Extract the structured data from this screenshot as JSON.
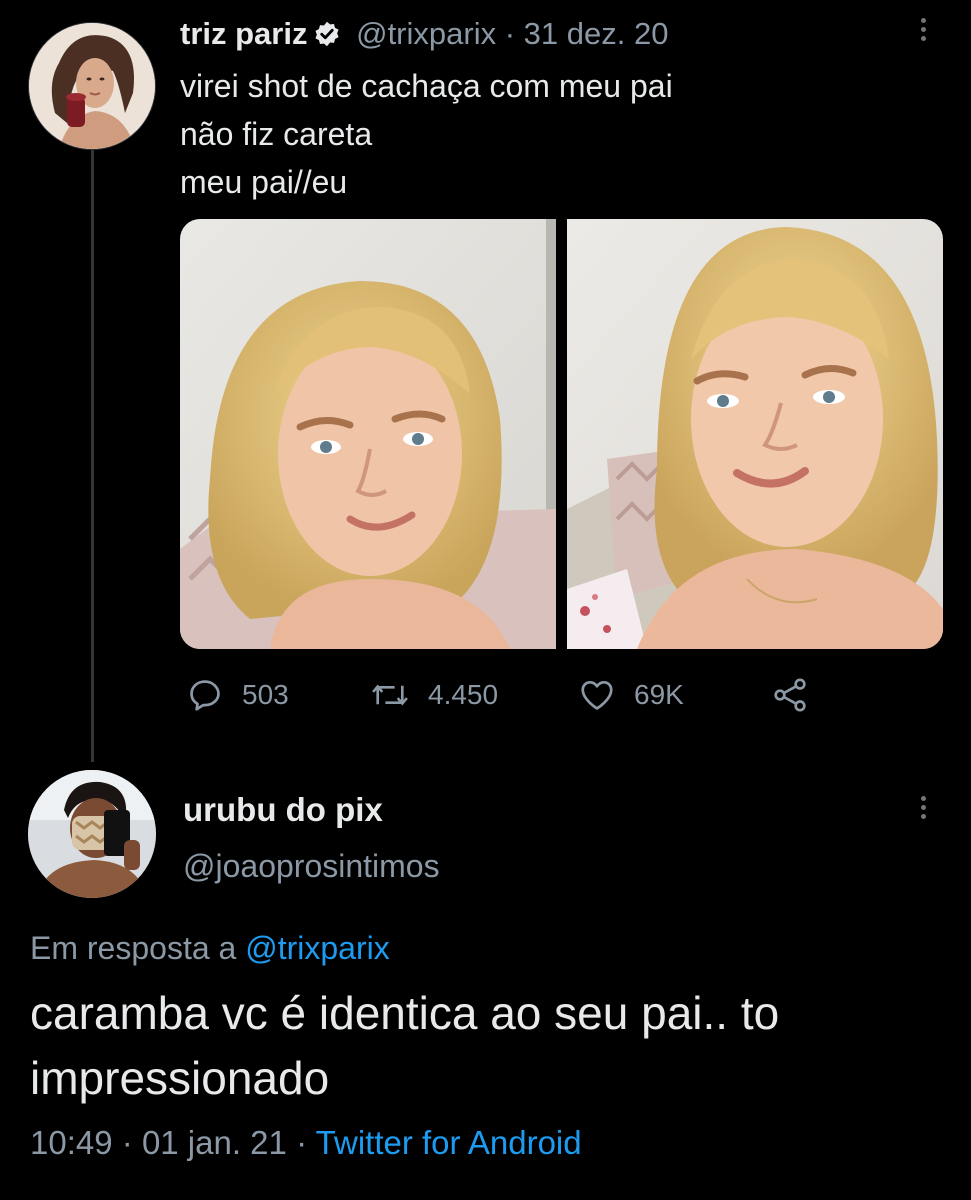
{
  "tweet": {
    "author_name": "triz pariz",
    "handle": "@trixparix",
    "date": "31 dez. 20",
    "separator": "·",
    "body_lines": [
      "virei shot de cachaça com meu pai",
      "não fiz careta",
      "meu pai//eu"
    ],
    "actions": {
      "replies": "503",
      "retweets": "4.450",
      "likes": "69K"
    },
    "icons": {
      "verified": "verified-badge-icon",
      "more": "more-options-icon",
      "reply": "reply-icon",
      "retweet": "retweet-icon",
      "like": "heart-icon",
      "share": "share-icon"
    }
  },
  "reply": {
    "author_name": "urubu do pix",
    "handle": "@joaoprosintimos",
    "replying_prefix": "Em resposta a",
    "replying_to": "@trixparix",
    "text": "caramba vc é identica ao seu pai.. to impressionado",
    "time": "10:49",
    "date": "01 jan. 21",
    "separator": "·",
    "source": "Twitter for Android"
  },
  "colors": {
    "background": "#000000",
    "text": "#e7e9ea",
    "muted": "#8b98a5",
    "link": "#1d9bf0",
    "thread_line": "#333639"
  }
}
